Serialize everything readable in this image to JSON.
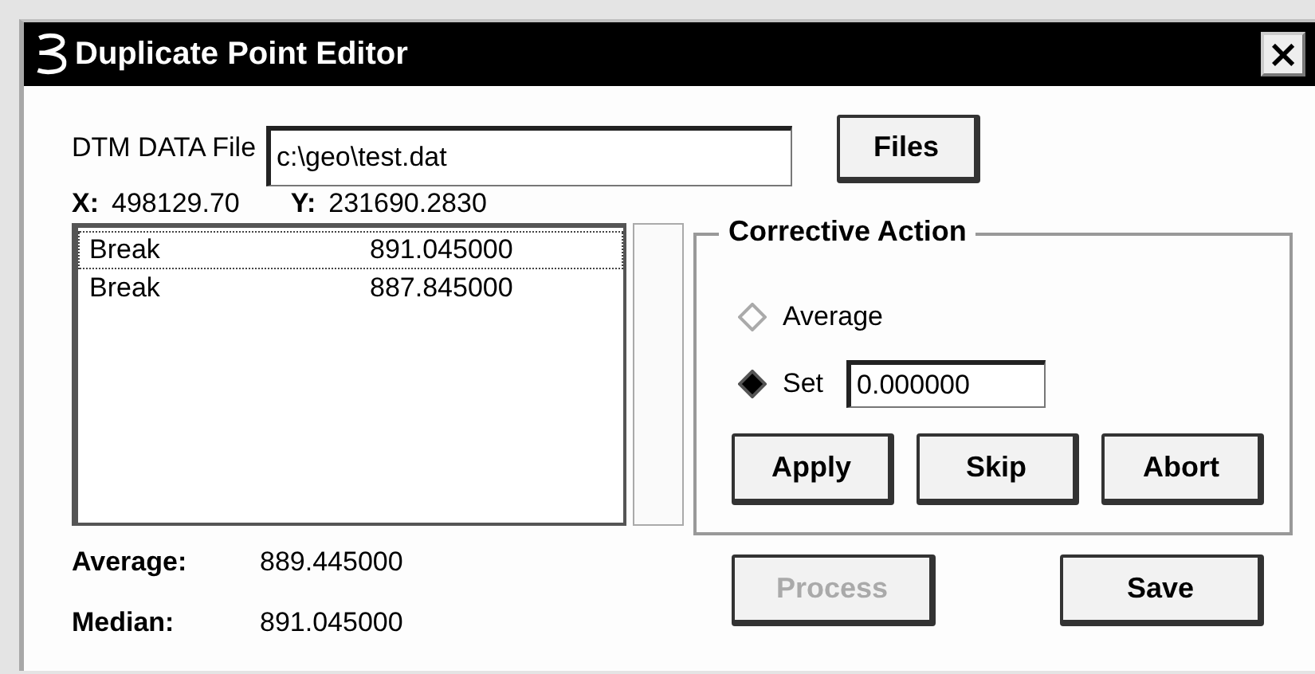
{
  "window": {
    "title": "Duplicate Point Editor",
    "close": "×"
  },
  "file": {
    "label": "DTM DATA File",
    "value": "c:\\geo\\test.dat",
    "button": "Files"
  },
  "coords": [
    {
      "label": "X:",
      "value": "498129.70"
    },
    {
      "label": "Y:",
      "value": "231690.2830"
    }
  ],
  "points": [
    {
      "type": "Break",
      "value": "891.045000",
      "selected": true
    },
    {
      "type": "Break",
      "value": "887.845000",
      "selected": false
    }
  ],
  "stats": [
    {
      "label": "Average:",
      "value": "889.445000"
    },
    {
      "label": "Median:",
      "value": "891.045000"
    }
  ],
  "corrective_action": {
    "title": "Corrective Action",
    "options": [
      {
        "label": "Average",
        "selected": false
      },
      {
        "label": "Set",
        "selected": true,
        "value": "0.000000"
      }
    ],
    "buttons": [
      "Apply",
      "Skip",
      "Abort"
    ]
  },
  "buttons": [
    {
      "label": "Process",
      "disabled": true
    },
    {
      "label": "Save",
      "disabled": false
    }
  ]
}
